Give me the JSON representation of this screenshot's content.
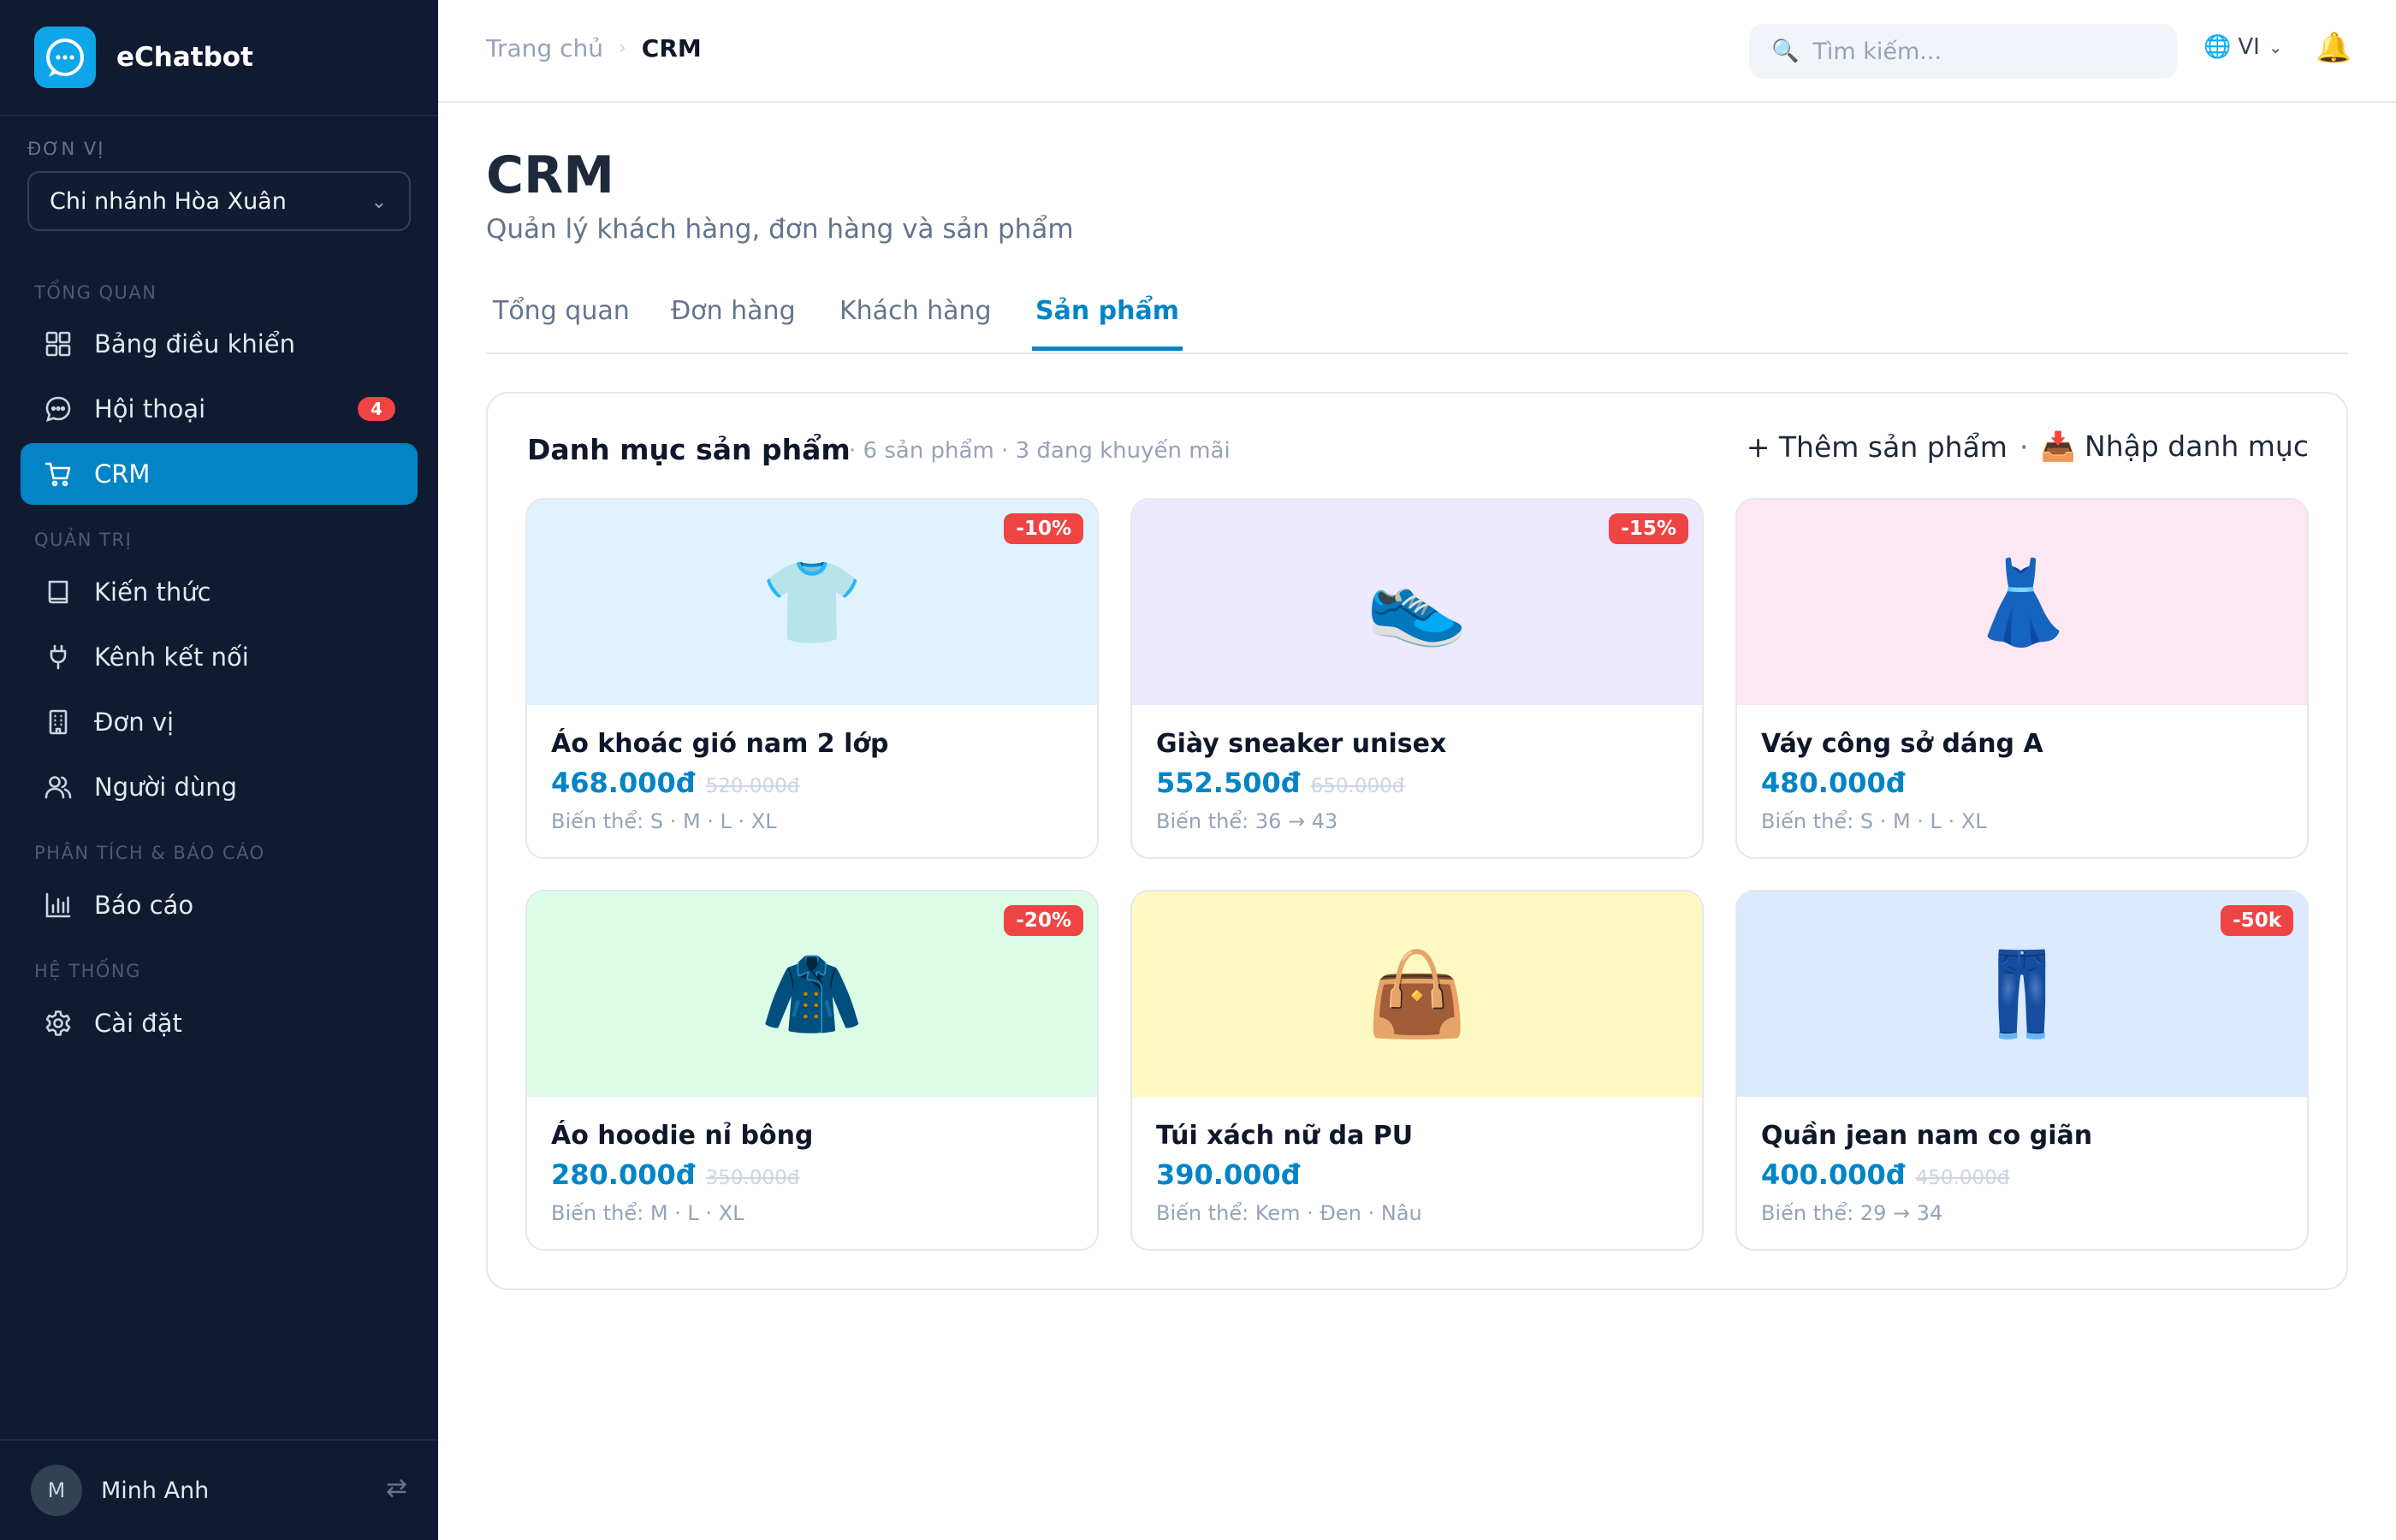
{
  "brand": {
    "name": "eChatbot"
  },
  "sidebar": {
    "unit_label": "ĐƠN VỊ",
    "unit_value": "Chi nhánh Hòa Xuân",
    "groups": [
      "TỔNG QUAN",
      "QUẢN TRỊ",
      "PHÂN TÍCH & BÁO CÁO",
      "HỆ THỐNG"
    ],
    "items": [
      {
        "label": "Bảng điều khiển",
        "icon": "grid-icon"
      },
      {
        "label": "Hội thoại",
        "icon": "chat-icon",
        "badge": "4"
      },
      {
        "label": "CRM",
        "icon": "cart-icon",
        "active": true
      },
      {
        "label": "Kiến thức",
        "icon": "book-icon"
      },
      {
        "label": "Kênh kết nối",
        "icon": "plug-icon"
      },
      {
        "label": "Đơn vị",
        "icon": "building-icon"
      },
      {
        "label": "Người dùng",
        "icon": "users-icon"
      },
      {
        "label": "Báo cáo",
        "icon": "bar-chart-icon"
      },
      {
        "label": "Cài đặt",
        "icon": "gear-icon"
      }
    ],
    "user": {
      "initial": "M",
      "name": "Minh Anh"
    }
  },
  "topbar": {
    "breadcrumb": {
      "home": "Trang chủ",
      "current": "CRM"
    },
    "search_placeholder": "Tìm kiếm...",
    "lang": "VI"
  },
  "page": {
    "title": "CRM",
    "subtitle": "Quản lý khách hàng, đơn hàng và sản phẩm",
    "tabs": [
      "Tổng quan",
      "Đơn hàng",
      "Khách hàng",
      "Sản phẩm"
    ],
    "active_tab": "Sản phẩm"
  },
  "catalog": {
    "title": "Danh mục sản phẩm",
    "meta": "· 6 sản phẩm · 3 đang khuyến mãi",
    "add_label": "+ Thêm sản phẩm",
    "separator": "·",
    "import_label": "📥 Nhập danh mục",
    "products": [
      {
        "name": "Áo khoác gió nam 2 lớp",
        "price": "468.000đ",
        "old_price": "520.000đ",
        "discount": "-10%",
        "variants": "Biến thể: S · M · L · XL",
        "emoji": "👕",
        "bg": "#e0f2fe"
      },
      {
        "name": "Giày sneaker unisex",
        "price": "552.500đ",
        "old_price": "650.000đ",
        "discount": "-15%",
        "variants": "Biến thể: 36 → 43",
        "emoji": "👟",
        "bg": "#ede9fe"
      },
      {
        "name": "Váy công sở dáng A",
        "price": "480.000đ",
        "old_price": "",
        "discount": "",
        "variants": "Biến thể: S · M · L · XL",
        "emoji": "👗",
        "bg": "#fce7f3"
      },
      {
        "name": "Áo hoodie nỉ bông",
        "price": "280.000đ",
        "old_price": "350.000đ",
        "discount": "-20%",
        "variants": "Biến thể: M · L · XL",
        "emoji": "🧥",
        "bg": "#dcfce7"
      },
      {
        "name": "Túi xách nữ da PU",
        "price": "390.000đ",
        "old_price": "",
        "discount": "",
        "variants": "Biến thể: Kem · Đen · Nâu",
        "emoji": "👜",
        "bg": "#fef9c3"
      },
      {
        "name": "Quần jean nam co giãn",
        "price": "400.000đ",
        "old_price": "450.000đ",
        "discount": "-50k",
        "variants": "Biến thể: 29 → 34",
        "emoji": "👖",
        "bg": "#dbeafe"
      }
    ]
  }
}
